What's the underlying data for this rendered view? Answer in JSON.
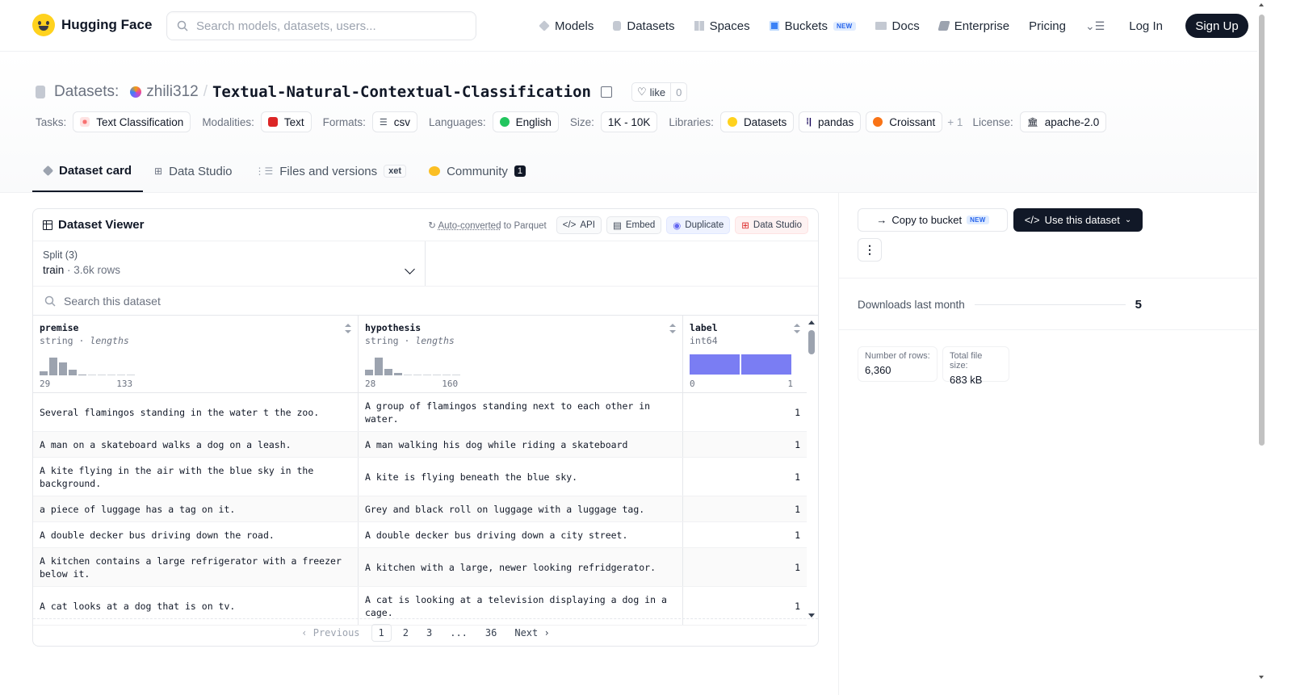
{
  "nav": {
    "brand": "Hugging Face",
    "search_placeholder": "Search models, datasets, users...",
    "links": [
      {
        "label": "Models",
        "icon": "models-icon"
      },
      {
        "label": "Datasets",
        "icon": "datasets-icon"
      },
      {
        "label": "Spaces",
        "icon": "spaces-icon"
      },
      {
        "label": "Buckets",
        "icon": "buckets-icon",
        "badge": "NEW"
      },
      {
        "label": "Docs",
        "icon": "docs-icon"
      },
      {
        "label": "Enterprise",
        "icon": "enterprise-icon"
      },
      {
        "label": "Pricing"
      }
    ],
    "login": "Log In",
    "signup": "Sign Up"
  },
  "header": {
    "section": "Datasets:",
    "owner": "zhili312",
    "separator": "/",
    "repo": "Textual-Natural-Contextual-Classification",
    "like_label": "like",
    "like_count": "0",
    "tags": {
      "tasks_label": "Tasks:",
      "task": "Text Classification",
      "modalities_label": "Modalities:",
      "modality": "Text",
      "formats_label": "Formats:",
      "format": "csv",
      "languages_label": "Languages:",
      "language": "English",
      "size_label": "Size:",
      "size": "1K - 10K",
      "libraries_label": "Libraries:",
      "lib1": "Datasets",
      "lib2": "pandas",
      "lib3": "Croissant",
      "lib_more": "+ 1",
      "license_label": "License:",
      "license": "apache-2.0"
    },
    "tabs": {
      "card": "Dataset card",
      "studio": "Data Studio",
      "files": "Files and versions",
      "xet": "xet",
      "community": "Community",
      "community_count": "1"
    }
  },
  "viewer": {
    "title": "Dataset Viewer",
    "auto_converted": "Auto-converted",
    "to_parquet": " to Parquet",
    "api": "API",
    "embed": "Embed",
    "duplicate": "Duplicate",
    "data_studio": "Data Studio",
    "split_label": "Split (3)",
    "split_value": "train",
    "split_rows": "3.6k rows",
    "search_placeholder": "Search this dataset",
    "columns": [
      {
        "name": "premise",
        "type": "string",
        "sub": "lengths",
        "min": "29",
        "max": "133",
        "hist": [
          0.2,
          0.85,
          0.6,
          0.25,
          0.05,
          0,
          0,
          0,
          0,
          0
        ]
      },
      {
        "name": "hypothesis",
        "type": "string",
        "sub": "lengths",
        "min": "28",
        "max": "160",
        "hist": [
          0.25,
          0.85,
          0.3,
          0.1,
          0,
          0,
          0,
          0,
          0,
          0
        ]
      },
      {
        "name": "label",
        "type": "int64",
        "min": "0",
        "max": "1"
      }
    ],
    "rows": [
      {
        "premise": "Several flamingos standing in the water t the zoo.",
        "hypothesis": "A group of flamingos standing next to each other in water.",
        "label": "1"
      },
      {
        "premise": "A man on a skateboard walks a dog on a leash.",
        "hypothesis": "A man walking his dog while riding a skateboard",
        "label": "1"
      },
      {
        "premise": "A kite flying in the air with the blue sky in the background.",
        "hypothesis": "A kite is flying beneath the blue sky.",
        "label": "1"
      },
      {
        "premise": "a piece of luggage has a tag on it.",
        "hypothesis": "Grey and black roll on luggage with a luggage tag.",
        "label": "1"
      },
      {
        "premise": "A double decker bus driving down the road.",
        "hypothesis": "A double decker bus driving down a city street.",
        "label": "1"
      },
      {
        "premise": "A kitchen contains a large refrigerator with a freezer below it.",
        "hypothesis": "A kitchen with a large, newer looking refridgerator.",
        "label": "1"
      },
      {
        "premise": "A cat looks at a dog that is on tv.",
        "hypothesis": "A cat is looking at a television displaying a dog in a cage.",
        "label": "1"
      }
    ],
    "pager": {
      "prev": "Previous",
      "pages": [
        "1",
        "2",
        "3",
        "...",
        "36"
      ],
      "next": "Next"
    }
  },
  "side": {
    "copy_bucket": "Copy to bucket",
    "copy_badge": "NEW",
    "use_dataset": "Use this dataset",
    "more": "⋮",
    "downloads_label": "Downloads last month",
    "downloads": "5",
    "rows_label": "Number of rows:",
    "rows": "6,360",
    "size_label": "Total file size:",
    "size": "683 kB"
  },
  "colors": {
    "accent": "#6366f1",
    "dark": "#111827",
    "brand": "#ffd21e"
  }
}
